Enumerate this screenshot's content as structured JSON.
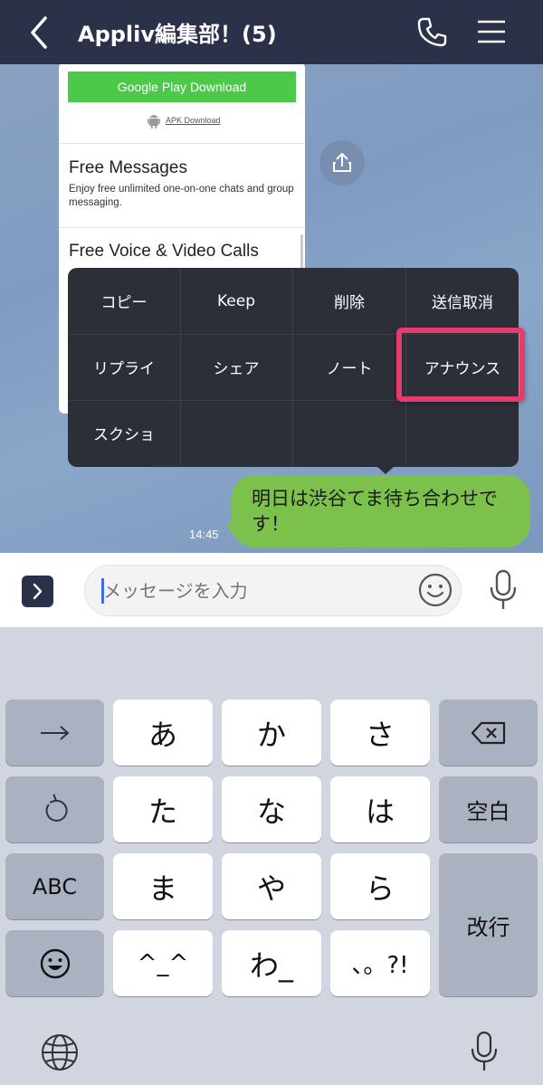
{
  "header": {
    "title": "Appliv編集部！(5)",
    "back_icon": "chevron-left-icon",
    "call_icon": "phone-icon",
    "menu_icon": "hamburger-menu-icon"
  },
  "chat": {
    "card": {
      "google_play": "Google Play Download",
      "apk_link": "APK Download",
      "feature1_title": "Free Messages",
      "feature1_desc": "Enjoy free unlimited one-on-one chats and group messaging.",
      "feature2_title": "Free Voice & Video Calls"
    },
    "share_icon": "share-icon",
    "message": "明日は渋谷てま待ち合わせです！",
    "time": "14:45"
  },
  "context_menu": {
    "items": [
      "コピー",
      "Keep",
      "削除",
      "送信取消",
      "リプライ",
      "シェア",
      "ノート",
      "アナウンス",
      "スクショ"
    ],
    "highlighted": "アナウンス",
    "highlight_color": "#e83a6e"
  },
  "input_bar": {
    "placeholder": "メッセージを入力",
    "expand_icon": "chevron-right-icon",
    "emoji_icon": "smiley-icon",
    "mic_icon": "microphone-icon"
  },
  "keyboard": {
    "left_keys": [
      "→",
      "ABC"
    ],
    "kana_keys": [
      "あ",
      "か",
      "さ",
      "た",
      "な",
      "は",
      "ま",
      "や",
      "ら",
      "^_^",
      "わ_",
      "、。?!"
    ],
    "right_keys": [
      "空白",
      "改行"
    ],
    "icons": [
      "arrow-right-icon",
      "backspace-icon",
      "undo-icon",
      "emoji-icon",
      "globe-icon",
      "microphone-icon"
    ]
  },
  "colors": {
    "header_bg": "#2b3149",
    "bubble": "#7cc14c",
    "google_play_green": "#4cc948",
    "menu_bg": "#2d2f38"
  }
}
